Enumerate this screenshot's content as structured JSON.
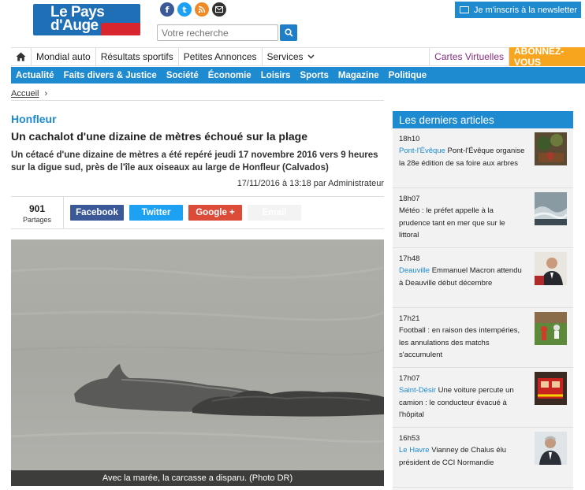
{
  "header": {
    "logo_line1": "Le Pays",
    "logo_line2": "d'Auge",
    "social": [
      {
        "icon": "facebook-icon",
        "glyph": "f",
        "color": "#3b5998"
      },
      {
        "icon": "twitter-icon",
        "glyph": "t",
        "color": "#1da1f2"
      },
      {
        "icon": "rss-icon",
        "glyph": "r",
        "color": "#f08a24"
      },
      {
        "icon": "email-icon",
        "glyph": "@",
        "color": "#333333"
      }
    ],
    "search_placeholder": "Votre recherche",
    "newsletter_label": "Je m'inscris à la newsletter"
  },
  "main_nav": {
    "items": [
      "Mondial auto",
      "Résultats sportifs",
      "Petites Annonces",
      "Services"
    ],
    "cartes": "Cartes Virtuelles",
    "subscribe": "ABONNEZ-VOUS"
  },
  "sections": [
    "Actualité",
    "Faits divers & Justice",
    "Société",
    "Économie",
    "Loisirs",
    "Sports",
    "Magazine",
    "Politique"
  ],
  "breadcrumb": {
    "home": "Accueil",
    "sep": "›"
  },
  "article": {
    "category": "Honfleur",
    "title": "Un cachalot d'une dizaine de mètres échoué sur la plage",
    "lead": "Un cétacé d'une dizaine de mètres a été repéré jeudi 17 novembre 2016 vers 9 heures sur la digue sud, près de l'île aux oiseaux au large de Honfleur (Calvados)",
    "meta": "17/11/2016 à 13:18 par Administrateur",
    "shares_count": "901",
    "shares_label": "Partages",
    "share_buttons": {
      "facebook": "Facebook",
      "twitter": "Twitter",
      "google": "Google +",
      "email": "Email"
    },
    "caption": "Avec la marée, la carcasse a disparu. (Photo DR)"
  },
  "sidebar": {
    "title": "Les derniers articles",
    "items": [
      {
        "time": "18h10",
        "place": "Pont-l'Évêque",
        "text": " Pont-l'Évêque organise la 28e édition de sa foire aux arbres"
      },
      {
        "time": "18h07",
        "place": "",
        "text": "Météo : le préfet appelle à la prudence tant en mer que sur le littoral"
      },
      {
        "time": "17h48",
        "place": "Deauville",
        "text": " Emmanuel Macron attendu à Deauville début décembre"
      },
      {
        "time": "17h21",
        "place": "",
        "text": "Football : en raison des intempéries, les annulations des matchs s'accumulent"
      },
      {
        "time": "17h07",
        "place": "Saint-Désir",
        "text": " Une voiture percute un camion : le conducteur évacué à l'hôpital"
      },
      {
        "time": "16h53",
        "place": "Le Havre",
        "text": " Vianney de Chalus élu président de CCI Normandie"
      }
    ]
  },
  "colors": {
    "brand_blue": "#1e8ad0",
    "logo_red": "#d8262f",
    "subscribe_orange": "#f7a51e",
    "cartes_purple": "#8a2c87"
  }
}
